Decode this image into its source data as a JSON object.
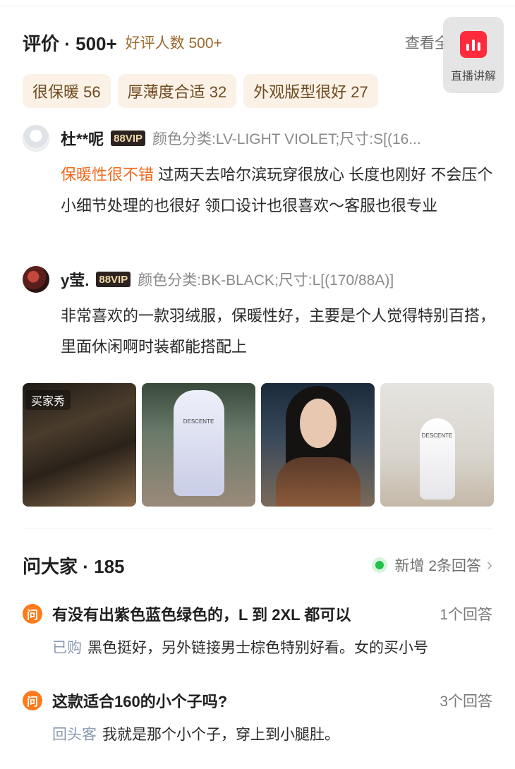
{
  "reviews": {
    "title": "评价 · 500+",
    "subtitle": "好评人数 500+",
    "see_all": "查看全部",
    "tags": [
      {
        "label": "很保暖 56"
      },
      {
        "label": "厚薄度合适 32"
      },
      {
        "label": "外观版型很好 27"
      }
    ],
    "items": [
      {
        "username": "杜**呢",
        "vip": "88VIP",
        "spec": "颜色分类:LV-LIGHT VIOLET;尺寸:S[(16...",
        "highlight": "保暖性很不错",
        "text": " 过两天去哈尔滨玩穿很放心 长度也刚好 不会压个 小细节处理的也很好 领口设计也很喜欢～客服也很专业"
      },
      {
        "username": "y莹.",
        "vip": "88VIP",
        "spec": "颜色分类:BK-BLACK;尺寸:L[(170/88A)]",
        "text": "非常喜欢的一款羽绒服，保暖性好，主要是个人觉得特别百搭，里面休闲啊时装都能搭配上"
      }
    ],
    "photos": {
      "badge": "买家秀",
      "coat_brand": "DESCENTE"
    }
  },
  "live": {
    "label": "直播讲解",
    "accent": "#ff2b3c"
  },
  "qa": {
    "title": "问大家 · 185",
    "new_answers": "新增 2条回答",
    "items": [
      {
        "badge": "问",
        "question": "有没有出紫色蓝色绿色的，L 到 2XL 都可以",
        "count": "1个回答",
        "answer_label": "已购",
        "answer": "黑色挺好，另外链接男士棕色特别好看。女的买小号"
      },
      {
        "badge": "问",
        "question": "这款适合160的小个子吗?",
        "count": "3个回答",
        "answer_label": "回头客",
        "answer": "我就是那个小个子，穿上到小腿肚。"
      }
    ]
  },
  "colors": {
    "highlight": "#f06a1d",
    "tag_bg": "#fbf1e6",
    "question_badge": "#ff7a1a",
    "new_dot": "#21c04a"
  }
}
